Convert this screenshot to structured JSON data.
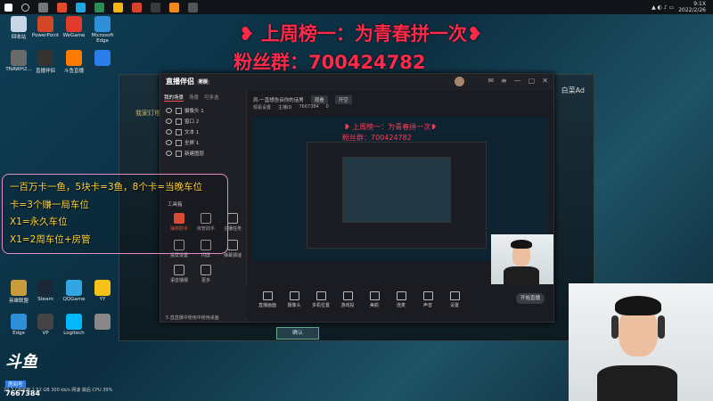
{
  "taskbar": {
    "clock_time": "9:1X",
    "clock_date": "2022/2/26",
    "icon_colors": [
      "#0b6fd6",
      "#ffffff",
      "#1ea7e4",
      "#e24b2b",
      "#2e8b57",
      "#f5b50e",
      "#d9422b",
      "#3a3a3a",
      "#f08a1a",
      "#555555"
    ]
  },
  "overlay": {
    "line1": "❥ 上周榜一：为青春拼一次❥",
    "line2": "粉丝群：700424782"
  },
  "desktop_icons": [
    {
      "label": "回收站",
      "color": "#c7d7e6"
    },
    {
      "label": "PowerPoint",
      "color": "#d24726"
    },
    {
      "label": "WeGame",
      "color": "#e23b2b"
    },
    {
      "label": "Microsoft Edge",
      "color": "#2f8fd8"
    },
    {
      "label": "TNAWH2...",
      "color": "#6a6a6a"
    },
    {
      "label": "直播伴侣",
      "color": "#333333"
    },
    {
      "label": "斗鱼直播",
      "color": "#ff7a00"
    },
    {
      "label": "",
      "color": "#2b7de9"
    },
    {
      "label": "英雄联盟",
      "color": "#c89b3c"
    },
    {
      "label": "Steam",
      "color": "#1b2838"
    },
    {
      "label": "QQGame",
      "color": "#31a6e3"
    },
    {
      "label": "YY",
      "color": "#f6c218"
    },
    {
      "label": "Edge",
      "color": "#2f8fd8"
    },
    {
      "label": "VP",
      "color": "#444"
    },
    {
      "label": "Logitech",
      "color": "#00b8fc"
    },
    {
      "label": "",
      "color": "#888"
    }
  ],
  "game_client": {
    "left_title": "我家灯塔",
    "right_name": "白菜Ad",
    "confirm_label": "确认"
  },
  "app": {
    "title": "直播伴侣",
    "badge": "新版",
    "tabs": [
      "我的场景",
      "场景",
      "可多选"
    ],
    "layers": [
      "摄像头 1",
      "窗口 2",
      "文本 1",
      "全屏 1",
      "新建图层"
    ],
    "tools_title": "工具箱",
    "tools": [
      "抽奖助手",
      "房管助手",
      "主播任务",
      "投屏设置",
      "闪屏",
      "弹幕猜谜",
      "语音播报",
      "更多"
    ],
    "top_label": "风·一直想告诉你的话男",
    "top_pill1": "观看",
    "top_pill2": "开空",
    "sub_label1": "观看设置",
    "sub_label2": "主播ID",
    "sub_value1": "7667384",
    "sub_value2": "0",
    "status_text": "5 直直播中使用中使用桌面",
    "bottom_tools": [
      "直播画面",
      "摄像头",
      "多机位置",
      "游戏投",
      "美颜",
      "连麦",
      "声音",
      "设置"
    ],
    "start_label": "开始直播"
  },
  "preview": {
    "line1": "❥ 上周榜一：为青春拼一次❥",
    "line2": "粉丝群：700424782"
  },
  "annotation": {
    "line1": "一百万卡一鱼，5块卡=3鱼，8个卡=当晚车位",
    "line2": "卡=3个赚一局车位",
    "line3": "X1=永久车位",
    "line4": "X1=2周车位+房管"
  },
  "douyu": {
    "logo": "斗鱼",
    "sub": "房间号",
    "room_id": "7667384"
  },
  "status_strip": "24.3 GB可用  1.52 GB  300 kb/s 网速 最后 CPU 39%"
}
